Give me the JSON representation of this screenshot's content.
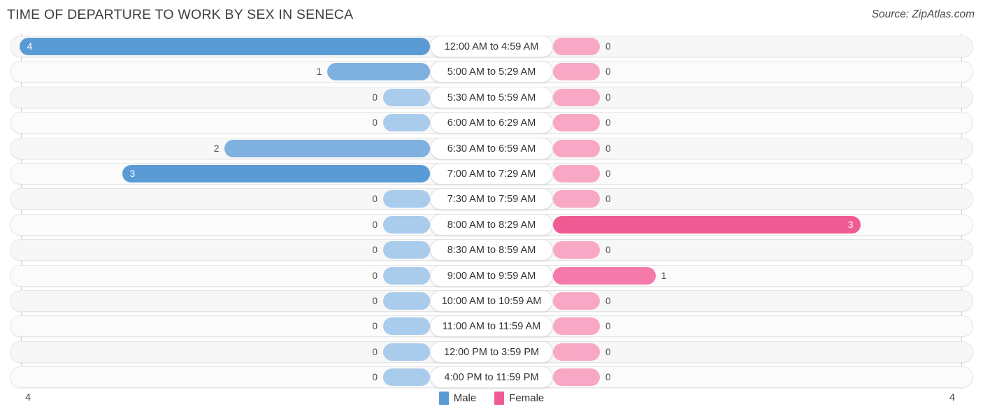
{
  "header": {
    "title": "TIME OF DEPARTURE TO WORK BY SEX IN SENECA",
    "source": "Source: ZipAtlas.com"
  },
  "legend": {
    "items": [
      {
        "label": "Male",
        "color": "#5b9bd5"
      },
      {
        "label": "Female",
        "color": "#ee5c94"
      }
    ]
  },
  "axis": {
    "left_tick": "4",
    "right_tick": "4"
  },
  "colors": {
    "male_strong": "#5b9bd5",
    "male_mid": "#7eb0e0",
    "male_zero": "#a9cbec",
    "female_strong": "#ef5c93",
    "female_mid": "#f47ba9",
    "female_zero": "#f8a8c4",
    "track": "#f7f7f7",
    "track_alt": "#fbfbfb"
  },
  "chart_data": {
    "type": "bar",
    "title": "TIME OF DEPARTURE TO WORK BY SEX IN SENECA",
    "orientation": "horizontal-diverging",
    "xlabel": "",
    "ylabel": "",
    "xlim": [
      4,
      4
    ],
    "grid": false,
    "legend_position": "bottom-center",
    "categories": [
      "12:00 AM to 4:59 AM",
      "5:00 AM to 5:29 AM",
      "5:30 AM to 5:59 AM",
      "6:00 AM to 6:29 AM",
      "6:30 AM to 6:59 AM",
      "7:00 AM to 7:29 AM",
      "7:30 AM to 7:59 AM",
      "8:00 AM to 8:29 AM",
      "8:30 AM to 8:59 AM",
      "9:00 AM to 9:59 AM",
      "10:00 AM to 10:59 AM",
      "11:00 AM to 11:59 AM",
      "12:00 PM to 3:59 PM",
      "4:00 PM to 11:59 PM"
    ],
    "series": [
      {
        "name": "Male",
        "values": [
          4,
          1,
          0,
          0,
          2,
          3,
          0,
          0,
          0,
          0,
          0,
          0,
          0,
          0
        ]
      },
      {
        "name": "Female",
        "values": [
          0,
          0,
          0,
          0,
          0,
          0,
          0,
          3,
          0,
          1,
          0,
          0,
          0,
          0
        ]
      }
    ]
  },
  "rows": [
    {
      "category": "12:00 AM to 4:59 AM",
      "male": "4",
      "female": "0"
    },
    {
      "category": "5:00 AM to 5:29 AM",
      "male": "1",
      "female": "0"
    },
    {
      "category": "5:30 AM to 5:59 AM",
      "male": "0",
      "female": "0"
    },
    {
      "category": "6:00 AM to 6:29 AM",
      "male": "0",
      "female": "0"
    },
    {
      "category": "6:30 AM to 6:59 AM",
      "male": "2",
      "female": "0"
    },
    {
      "category": "7:00 AM to 7:29 AM",
      "male": "3",
      "female": "0"
    },
    {
      "category": "7:30 AM to 7:59 AM",
      "male": "0",
      "female": "0"
    },
    {
      "category": "8:00 AM to 8:29 AM",
      "male": "0",
      "female": "3"
    },
    {
      "category": "8:30 AM to 8:59 AM",
      "male": "0",
      "female": "0"
    },
    {
      "category": "9:00 AM to 9:59 AM",
      "male": "0",
      "female": "1"
    },
    {
      "category": "10:00 AM to 10:59 AM",
      "male": "0",
      "female": "0"
    },
    {
      "category": "11:00 AM to 11:59 AM",
      "male": "0",
      "female": "0"
    },
    {
      "category": "12:00 PM to 3:59 PM",
      "male": "0",
      "female": "0"
    },
    {
      "category": "4:00 PM to 11:59 PM",
      "male": "0",
      "female": "0"
    }
  ]
}
